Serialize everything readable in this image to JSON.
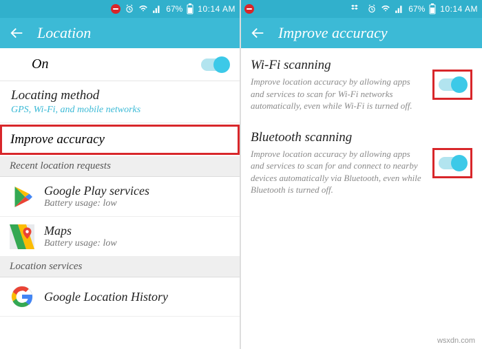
{
  "status": {
    "pct": "67%",
    "time": "10:14 AM"
  },
  "left": {
    "title": "Location",
    "on_label": "On",
    "locating": {
      "h": "Locating method",
      "sub": "GPS, Wi-Fi, and mobile networks"
    },
    "improve": "Improve accuracy",
    "recent_hdr": "Recent location requests",
    "apps": [
      {
        "name": "Google Play services",
        "bat": "Battery usage: low"
      },
      {
        "name": "Maps",
        "bat": "Battery usage: low"
      }
    ],
    "services_hdr": "Location services",
    "glh": "Google Location History"
  },
  "right": {
    "title": "Improve accuracy",
    "wifi": {
      "h": "Wi-Fi scanning",
      "d": "Improve location accuracy by allowing apps and services to scan for Wi-Fi networks automatically, even while Wi-Fi is turned off."
    },
    "bt": {
      "h": "Bluetooth scanning",
      "d": "Improve location accuracy by allowing apps and services to scan for and connect to nearby devices automatically via Bluetooth, even while Bluetooth is turned off."
    }
  },
  "watermark": "wsxdn.com"
}
